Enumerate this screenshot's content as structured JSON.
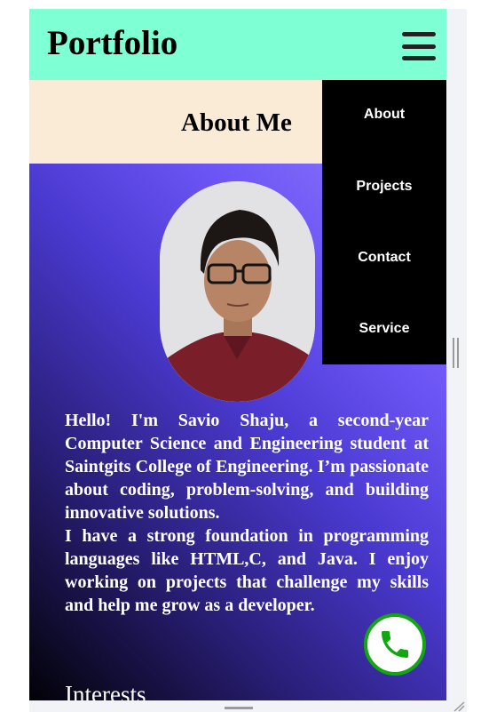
{
  "header": {
    "brand": "Portfolio",
    "menu_icon": "hamburger-icon"
  },
  "about": {
    "title": "About Me"
  },
  "nav": {
    "items": [
      {
        "label": "About"
      },
      {
        "label": "Projects"
      },
      {
        "label": "Contact"
      },
      {
        "label": "Service"
      }
    ]
  },
  "bio": {
    "paragraph_1": "Hello! I'm Savio Shaju, a second-year Computer Science and Engineering student at Saintgits College of Engineering. I’m passionate about coding, problem-solving, and building innovative solutions.",
    "paragraph_2": "I have a strong foundation in programming languages like HTML,C, and Java. I enjoy working on projects that challenge my skills and help me grow as a developer."
  },
  "interests": {
    "heading": "Interests"
  },
  "call_button": {
    "icon": "phone-icon"
  },
  "colors": {
    "header_bg": "#7fffd4",
    "about_bar_bg": "#faebd7",
    "menu_bg": "#000000",
    "gradient_start": "#000000",
    "gradient_end": "#8e7cfb",
    "call_accent": "#12a70f"
  }
}
